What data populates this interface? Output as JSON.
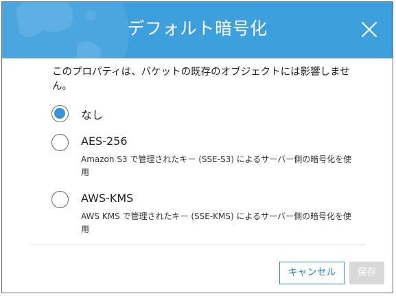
{
  "dialog": {
    "title": "デフォルト暗号化",
    "description": "このプロパティは、バケットの既存のオブジェクトには影響しません。"
  },
  "options": [
    {
      "label": "なし",
      "description": "",
      "selected": true
    },
    {
      "label": "AES-256",
      "description": "Amazon S3 で管理されたキー (SSE-S3) によるサーバー側の暗号化を使用",
      "selected": false
    },
    {
      "label": "AWS-KMS",
      "description": "AWS KMS で管理されたキー (SSE-KMS) によるサーバー側の暗号化を使用",
      "selected": false
    }
  ],
  "buttons": {
    "cancel": "キャンセル",
    "save": "保存"
  },
  "icons": {
    "close": "close-icon",
    "header_graphic": "globe-icon"
  },
  "colors": {
    "header": "#3e9fdd",
    "accent": "#3a95d6",
    "cancel_border": "#2f8fd0",
    "save_disabled": "#d9d9d9"
  }
}
